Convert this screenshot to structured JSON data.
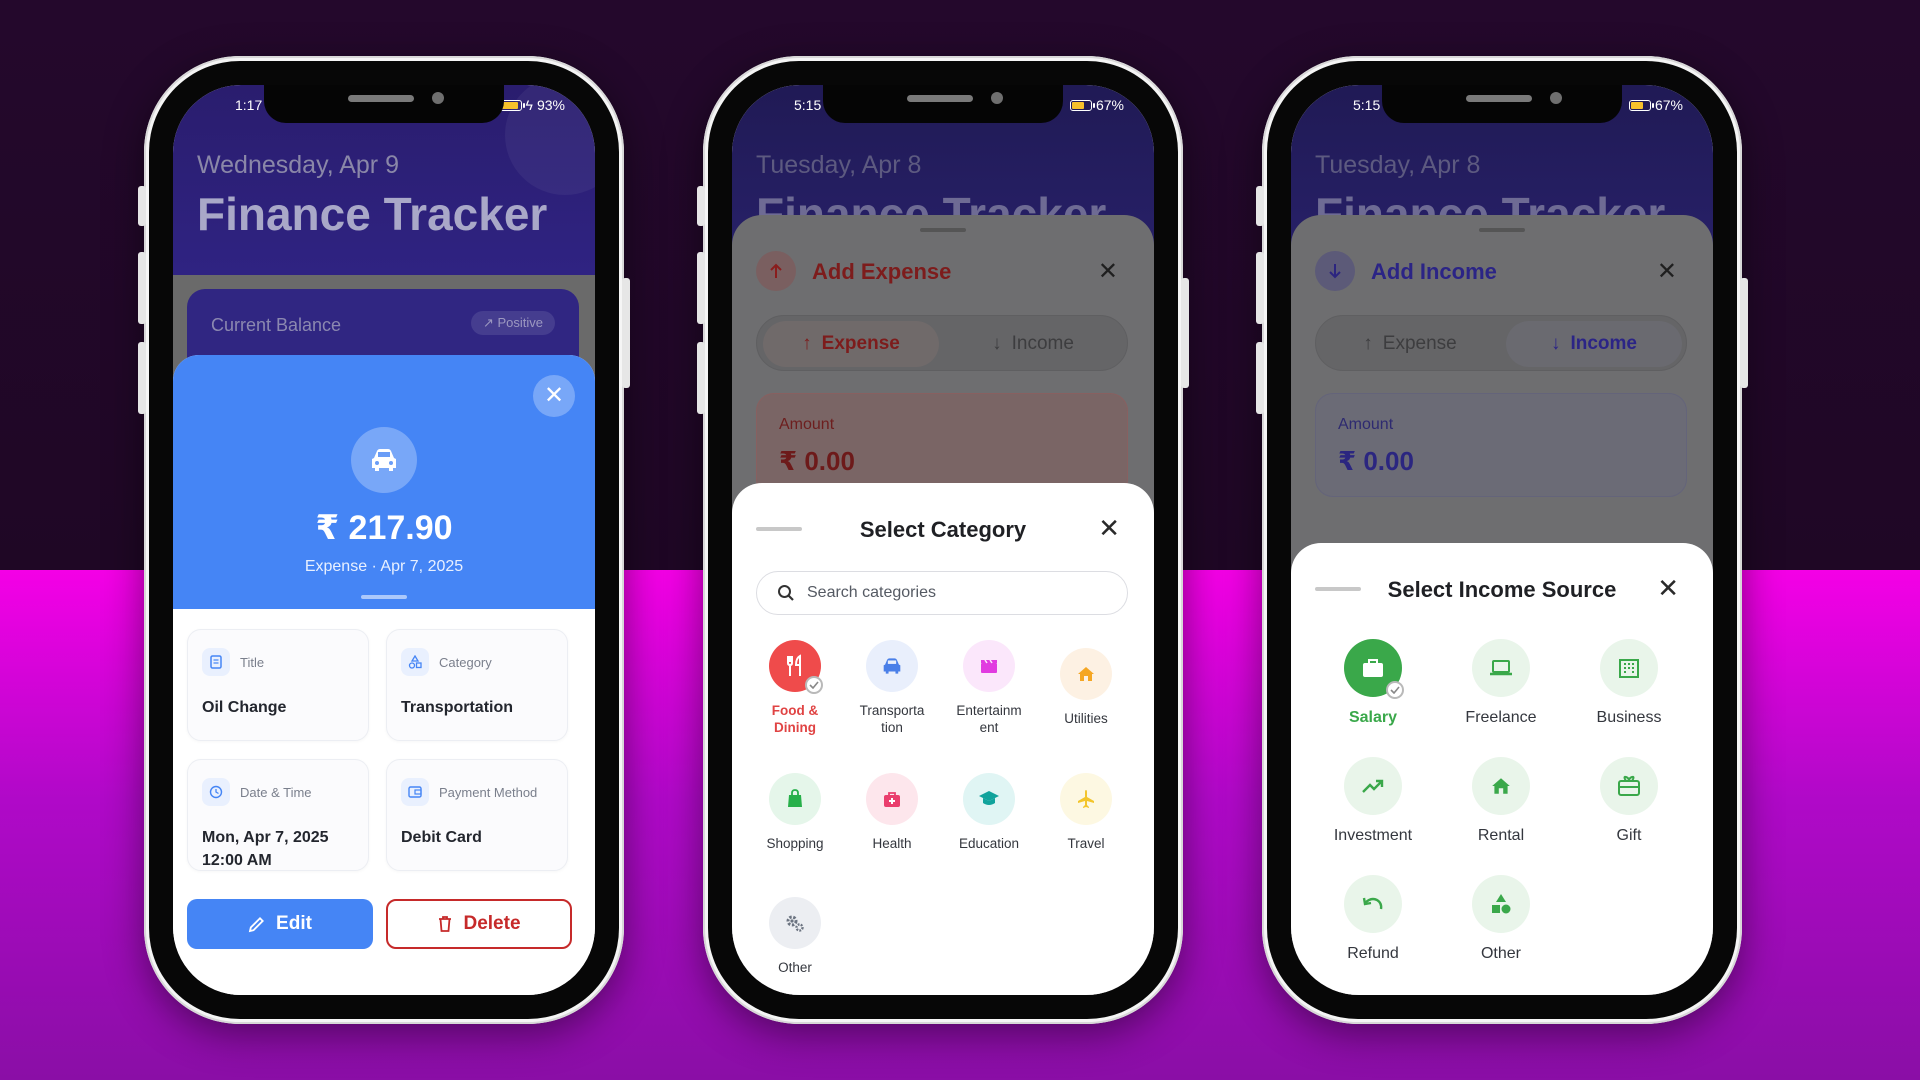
{
  "phone1": {
    "status_time": "1:17",
    "battery": "93%",
    "date": "Wednesday, Apr 9",
    "app_title": "Finance Tracker",
    "balance_label": "Current Balance",
    "balance_badge": "Positive",
    "close": "✕",
    "amount": "₹ 217.90",
    "subtitle": "Expense · Apr 7, 2025",
    "details": {
      "title_label": "Title",
      "title_value": "Oil Change",
      "category_label": "Category",
      "category_value": "Transportation",
      "date_label": "Date & Time",
      "date_value_1": "Mon, Apr 7, 2025",
      "date_value_2": "12:00 AM",
      "payment_label": "Payment Method",
      "payment_value": "Debit Card"
    },
    "edit_label": "Edit",
    "delete_label": "Delete",
    "accent": "#4585f5",
    "danger": "#c62a2a"
  },
  "phone2": {
    "status_time": "5:15",
    "battery": "67%",
    "date": "Tuesday, Apr 8",
    "app_title": "Finance Tracker",
    "sheet_title": "Add Expense",
    "tab_expense": "Expense",
    "tab_income": "Income",
    "amount_label": "Amount",
    "amount_value": "₹ 0.00",
    "picker_title": "Select Category",
    "search_placeholder": "Search categories",
    "categories": [
      {
        "name_1": "Food &",
        "name_2": "Dining"
      },
      {
        "name_1": "Transporta",
        "name_2": "tion"
      },
      {
        "name_1": "Entertainm",
        "name_2": "ent"
      },
      {
        "name_1": "Utilities"
      },
      {
        "name_1": "Shopping"
      },
      {
        "name_1": "Health"
      },
      {
        "name_1": "Education"
      },
      {
        "name_1": "Travel"
      },
      {
        "name_1": "Other"
      }
    ]
  },
  "phone3": {
    "status_time": "5:15",
    "battery": "67%",
    "date": "Tuesday, Apr 8",
    "app_title": "Finance Tracker",
    "sheet_title": "Add Income",
    "tab_expense": "Expense",
    "tab_income": "Income",
    "amount_label": "Amount",
    "amount_value": "₹ 0.00",
    "picker_title": "Select Income Source",
    "sources": [
      "Salary",
      "Freelance",
      "Business",
      "Investment",
      "Rental",
      "Gift",
      "Refund",
      "Other"
    ],
    "accent_green": "#3aa84a"
  }
}
